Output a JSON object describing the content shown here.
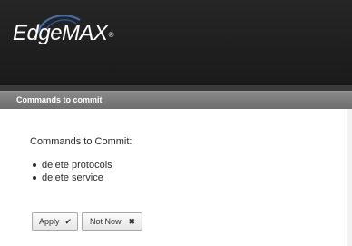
{
  "app": {
    "logo_main": "EdgeMAX"
  },
  "dialog": {
    "title": "Commands to commit",
    "heading": "Commands to Commit:",
    "commands": [
      "delete protocols",
      "delete service"
    ],
    "buttons": {
      "apply_label": "Apply",
      "apply_icon": "checkmark-icon",
      "not_now_label": "Not Now",
      "not_now_icon": "close-icon"
    }
  },
  "colors": {
    "header_bg": "#222222",
    "titlebar_bg": "#7a7a7a",
    "text": "#2b2b2b"
  }
}
